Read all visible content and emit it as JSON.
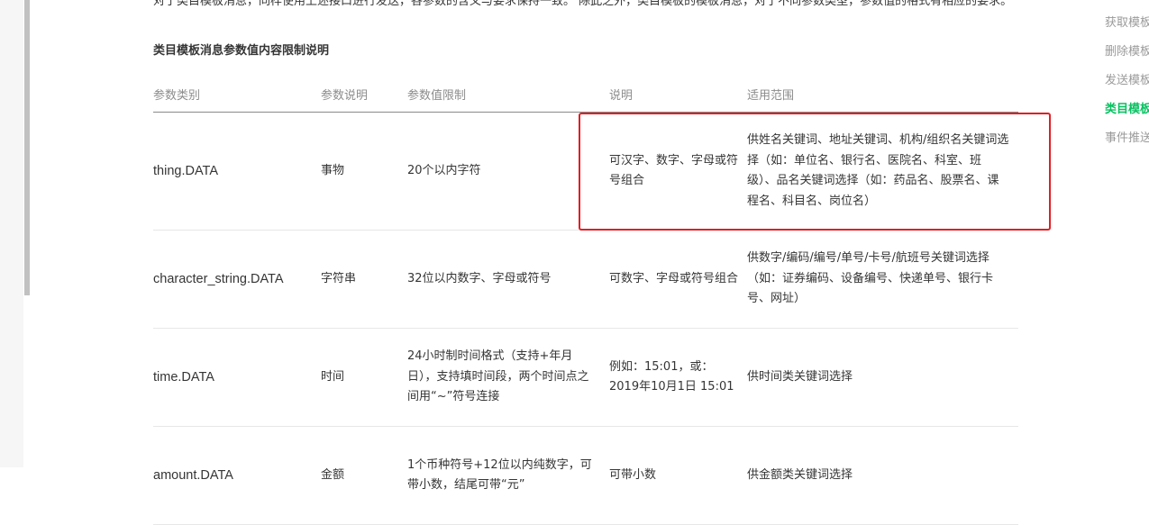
{
  "intro_text": "对于类目模板消息，同样使用上述接口进行发送，各参数的含义与要求保持一致。 除此之外，类目模板的模板消息，对于不同参数类型，参数值的格式有相应的要求。",
  "section_title": "类目模板消息参数值内容限制说明",
  "table": {
    "headers": [
      "参数类别",
      "参数说明",
      "参数值限制",
      "说明",
      "适用范围"
    ],
    "rows": [
      {
        "type": "thing.DATA",
        "name": "事物",
        "limit": "20个以内字符",
        "desc": "可汉字、数字、字母或符号组合",
        "scope": "供姓名关键词、地址关键词、机构/组织名关键词选择（如：单位名、银行名、医院名、科室、班级）、品名关键词选择（如：药品名、股票名、课程名、科目名、岗位名）"
      },
      {
        "type": "character_string.DATA",
        "name": "字符串",
        "limit": "32位以内数字、字母或符号",
        "desc": "可数字、字母或符号组合",
        "scope": "供数字/编码/编号/单号/卡号/航班号关键词选择（如：证券编码、设备编号、快递单号、银行卡号、网址）"
      },
      {
        "type": "time.DATA",
        "name": "时间",
        "limit": "24小时制时间格式（支持+年月日），支持填时间段，两个时间点之间用“~”符号连接",
        "desc": "例如：15:01，或：2019年10月1日 15:01",
        "scope": "供时间类关键词选择"
      },
      {
        "type": "amount.DATA",
        "name": "金额",
        "limit": "1个币种符号+12位以内纯数字，可带小数，结尾可带“元”",
        "desc": "可带小数",
        "scope": "供金额类关键词选择"
      }
    ]
  },
  "toc": {
    "items": [
      {
        "label": "获取模板列表",
        "active": false
      },
      {
        "label": "删除模板",
        "active": false
      },
      {
        "label": "发送模板消息",
        "active": false
      },
      {
        "label": "类目模板消息",
        "active": true
      },
      {
        "label": "事件推送",
        "active": false
      }
    ]
  },
  "colors": {
    "highlight_border": "#e31e24",
    "toc_active": "#07c160"
  }
}
